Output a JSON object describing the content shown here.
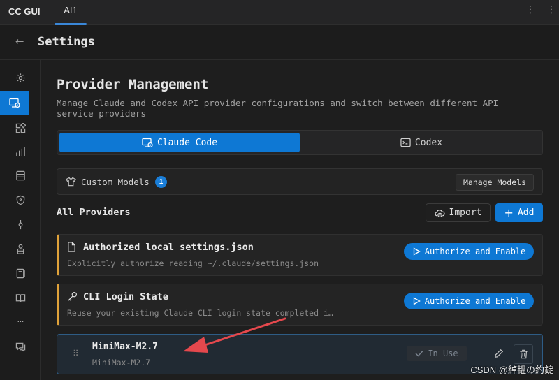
{
  "topbar": {
    "app_title": "CC GUI",
    "tab_label": "AI1",
    "icons": [
      "more-vertical-icon",
      "more-vertical-icon"
    ]
  },
  "header": {
    "back_icon": "arrow-left-icon",
    "title": "Settings"
  },
  "sidebar": {
    "items": [
      {
        "icon": "gear-icon"
      },
      {
        "icon": "provider-icon",
        "active": true
      },
      {
        "icon": "blocks-icon"
      },
      {
        "icon": "bar-chart-icon"
      },
      {
        "icon": "database-icon"
      },
      {
        "icon": "shield-icon"
      },
      {
        "icon": "commit-icon"
      },
      {
        "icon": "stack-icon"
      },
      {
        "icon": "book-stack-icon"
      },
      {
        "icon": "book-open-icon"
      },
      {
        "icon": "more-horizontal-icon",
        "text": "···"
      },
      {
        "icon": "chat-icon"
      }
    ]
  },
  "main": {
    "title": "Provider Management",
    "description": "Manage Claude and Codex API provider configurations and switch between different API service providers",
    "segments": [
      {
        "label": "Claude Code",
        "icon": "provider-icon",
        "active": true
      },
      {
        "label": "Codex",
        "icon": "terminal-icon",
        "active": false
      }
    ],
    "custom_models": {
      "label": "Custom Models",
      "count": "1",
      "manage_label": "Manage Models"
    },
    "section_title": "All Providers",
    "import_label": "Import",
    "add_label": "Add",
    "cards": [
      {
        "title": "Authorized local settings.json",
        "subtitle": "Explicitly authorize reading ~/.claude/settings.json",
        "icon": "file-icon",
        "button": "Authorize and Enable"
      },
      {
        "title": "CLI Login State",
        "subtitle": "Reuse your existing Claude CLI login state completed i…",
        "icon": "key-icon",
        "button": "Authorize and Enable"
      }
    ],
    "active_provider": {
      "title": "MiniMax-M2.7",
      "subtitle": "MiniMax-M2.7",
      "status": "In Use"
    }
  },
  "watermark": "CSDN @綽韫の約錠",
  "colors": {
    "accent": "#0e78d4",
    "warning_border": "#e0a23a",
    "annotation_arrow": "#e5484d"
  }
}
